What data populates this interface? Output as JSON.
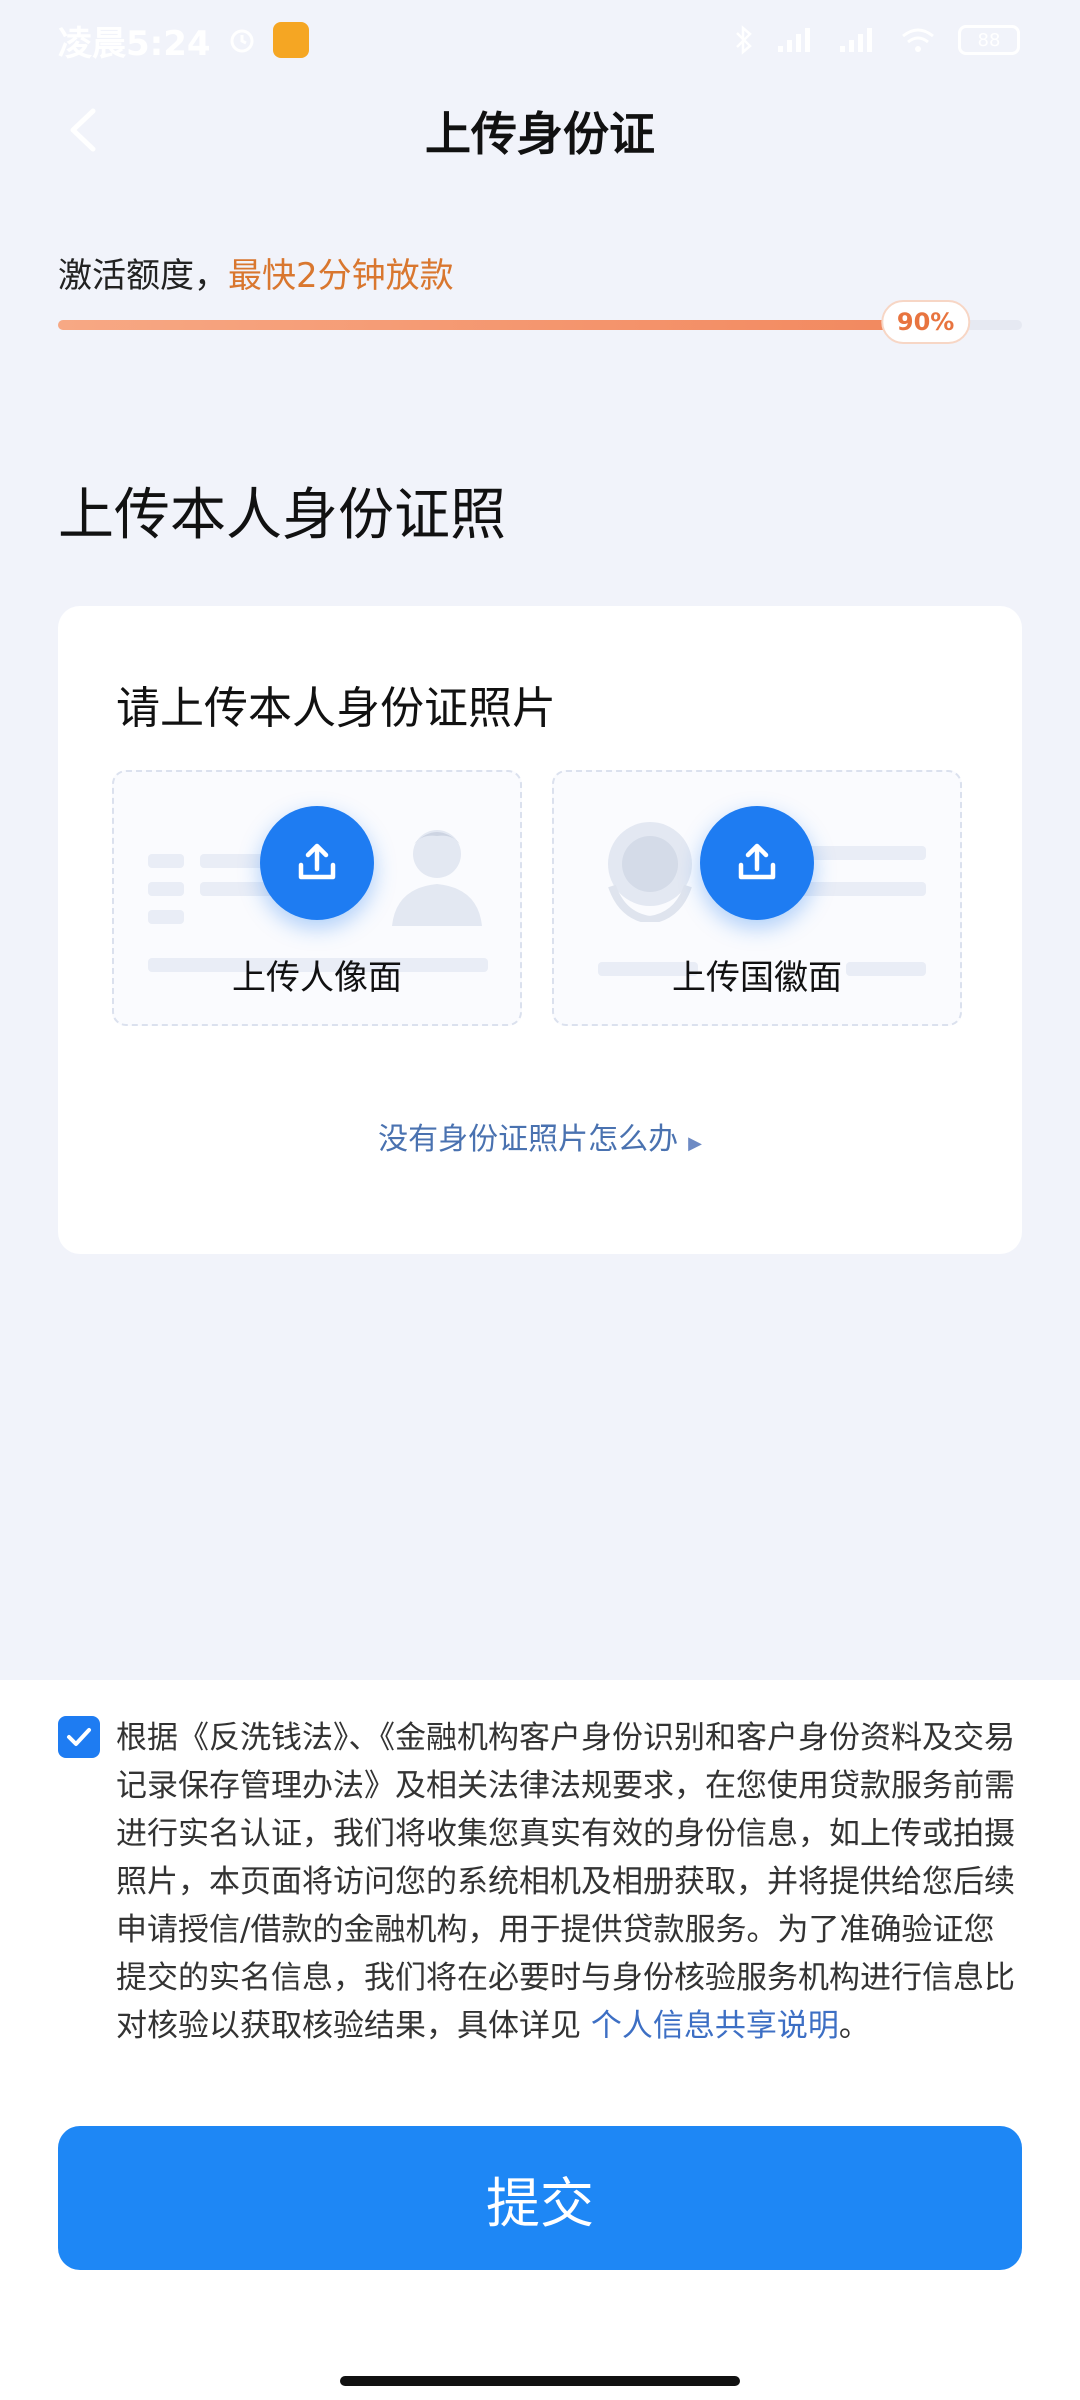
{
  "status_bar": {
    "time": "凌晨5:24",
    "battery": "88"
  },
  "header": {
    "title": "上传身份证"
  },
  "progress": {
    "label": "激活额度，",
    "highlight": "最快2分钟放款",
    "percent_text": "90%",
    "fraction": 0.9
  },
  "section": {
    "heading": "上传本人身份证照"
  },
  "upload_card": {
    "title": "请上传本人身份证照片",
    "front_label": "上传人像面",
    "back_label": "上传国徽面",
    "help_link": "没有身份证照片怎么办"
  },
  "consent": {
    "text": "根据《反洗钱法》、《金融机构客户身份识别和客户身份资料及交易记录保存管理办法》及相关法律法规要求，在您使用贷款服务前需进行实名认证，我们将收集您真实有效的身份信息，如上传或拍摄照片，本页面将访问您的系统相机及相册获取，并将提供给您后续申请授信/借款的金融机构，用于提供贷款服务。为了准确验证您提交的实名信息，我们将在必要时与身份核验服务机构进行信息比对核验以获取核验结果，具体详见",
    "link": "个人信息共享说明",
    "end": "。"
  },
  "submit_label": "提交",
  "colors": {
    "accent": "#1e7cf2",
    "progress": "#f2885e",
    "highlight": "#d9772f",
    "background": "#f1f3fa"
  },
  "icons": {
    "back": "chevron-left-icon",
    "upload": "upload-icon",
    "checkbox": "checkmark-icon"
  }
}
